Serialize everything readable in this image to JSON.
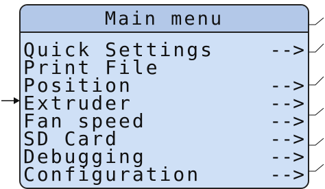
{
  "header": {
    "title": "Main menu"
  },
  "menu": {
    "items": [
      {
        "label": "Quick Settings",
        "chevron": "-->"
      },
      {
        "label": "Print File",
        "chevron": ""
      },
      {
        "label": "Position",
        "chevron": "-->"
      },
      {
        "label": "Extruder",
        "chevron": "-->"
      },
      {
        "label": "Fan speed",
        "chevron": "-->"
      },
      {
        "label": "SD Card",
        "chevron": "-->"
      },
      {
        "label": "Debugging",
        "chevron": "-->"
      },
      {
        "label": "Configuration",
        "chevron": "-->"
      }
    ],
    "selected_item": "Extruder"
  },
  "colors": {
    "screen_bg": "#cfe0f6",
    "header_bg": "#b3c8e8",
    "text": "#111111",
    "border": "#222222"
  },
  "icons": {
    "pointer": "right-arrow-icon",
    "callout": "callout-line-icon"
  }
}
